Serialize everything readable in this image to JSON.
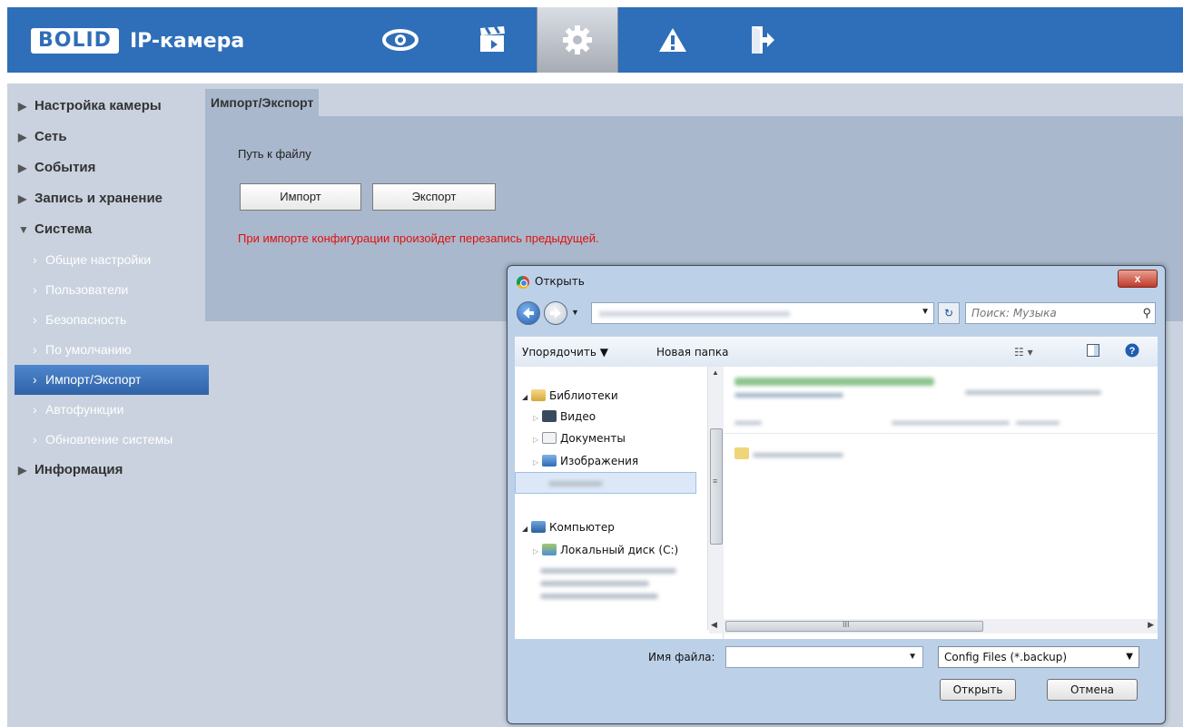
{
  "header": {
    "logo_box": "BOLID",
    "logo_text": "IP-камера",
    "nav": [
      "eye-icon",
      "clapperboard-icon",
      "gear-icon",
      "warning-icon",
      "logout-icon"
    ]
  },
  "sidebar": {
    "items": [
      {
        "label": "Настройка камеры"
      },
      {
        "label": "Сеть"
      },
      {
        "label": "События"
      },
      {
        "label": "Запись и хранение"
      },
      {
        "label": "Система"
      }
    ],
    "sub": [
      {
        "label": "Общие настройки"
      },
      {
        "label": "Пользователи"
      },
      {
        "label": "Безопасность"
      },
      {
        "label": "По умолчанию"
      },
      {
        "label": "Импорт/Экспорт"
      },
      {
        "label": "Автофункции"
      },
      {
        "label": "Обновление системы"
      }
    ],
    "last": {
      "label": "Информация"
    }
  },
  "main": {
    "tab": "Импорт/Экспорт",
    "path_label": "Путь к файлу",
    "import_label": "Импорт",
    "export_label": "Экспорт",
    "warning": "При импорте конфигурации произойдет перезапись предыдущей."
  },
  "dialog": {
    "title": "Открыть",
    "close": "x",
    "search_placeholder": "Поиск: Музыка",
    "toolbar": {
      "organize": "Упорядочить ▼",
      "new_folder": "Новая папка"
    },
    "tree": {
      "libraries": "Библиотеки",
      "video": "Видео",
      "documents": "Документы",
      "images": "Изображения",
      "computer": "Компьютер",
      "local_disk": "Локальный диск (C:)"
    },
    "filename_label": "Имя файла:",
    "filename_value": "",
    "filter": "Config Files (*.backup)",
    "open_button": "Открыть",
    "cancel_button": "Отмена",
    "hscroll_mark": "III",
    "tree_mark": "≡"
  },
  "colors": {
    "header": "#2f6eb8",
    "sidebar": "#c9d2de",
    "panel": "#a9b8cc",
    "active": "#2f63a8",
    "warning": "#e01010"
  }
}
